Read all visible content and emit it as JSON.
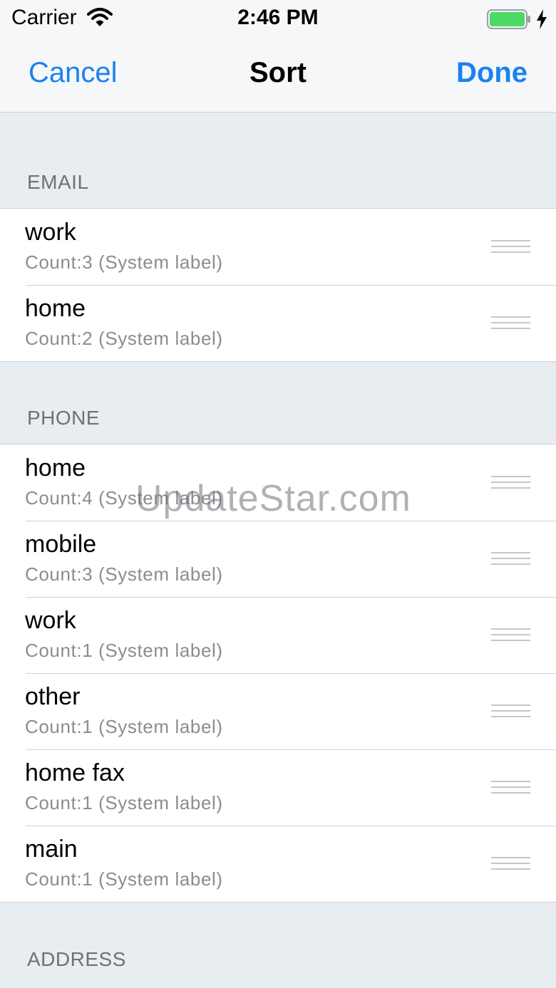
{
  "status_bar": {
    "carrier": "Carrier",
    "time": "2:46 PM",
    "battery_color": "#4cd964"
  },
  "nav": {
    "cancel_label": "Cancel",
    "title": "Sort",
    "done_label": "Done",
    "accent_color": "#1a82f0"
  },
  "sections": {
    "email": {
      "header": "EMAIL",
      "rows": [
        {
          "title": "work",
          "subtitle": "Count:3 (System label)"
        },
        {
          "title": "home",
          "subtitle": "Count:2 (System label)"
        }
      ]
    },
    "phone": {
      "header": "PHONE",
      "rows": [
        {
          "title": "home",
          "subtitle": "Count:4 (System label)"
        },
        {
          "title": "mobile",
          "subtitle": "Count:3 (System label)"
        },
        {
          "title": "work",
          "subtitle": "Count:1 (System label)"
        },
        {
          "title": "other",
          "subtitle": "Count:1 (System label)"
        },
        {
          "title": "home fax",
          "subtitle": "Count:1 (System label)"
        },
        {
          "title": "main",
          "subtitle": "Count:1 (System label)"
        }
      ]
    },
    "address": {
      "header": "ADDRESS"
    }
  },
  "watermark": "UpdateStar.com"
}
